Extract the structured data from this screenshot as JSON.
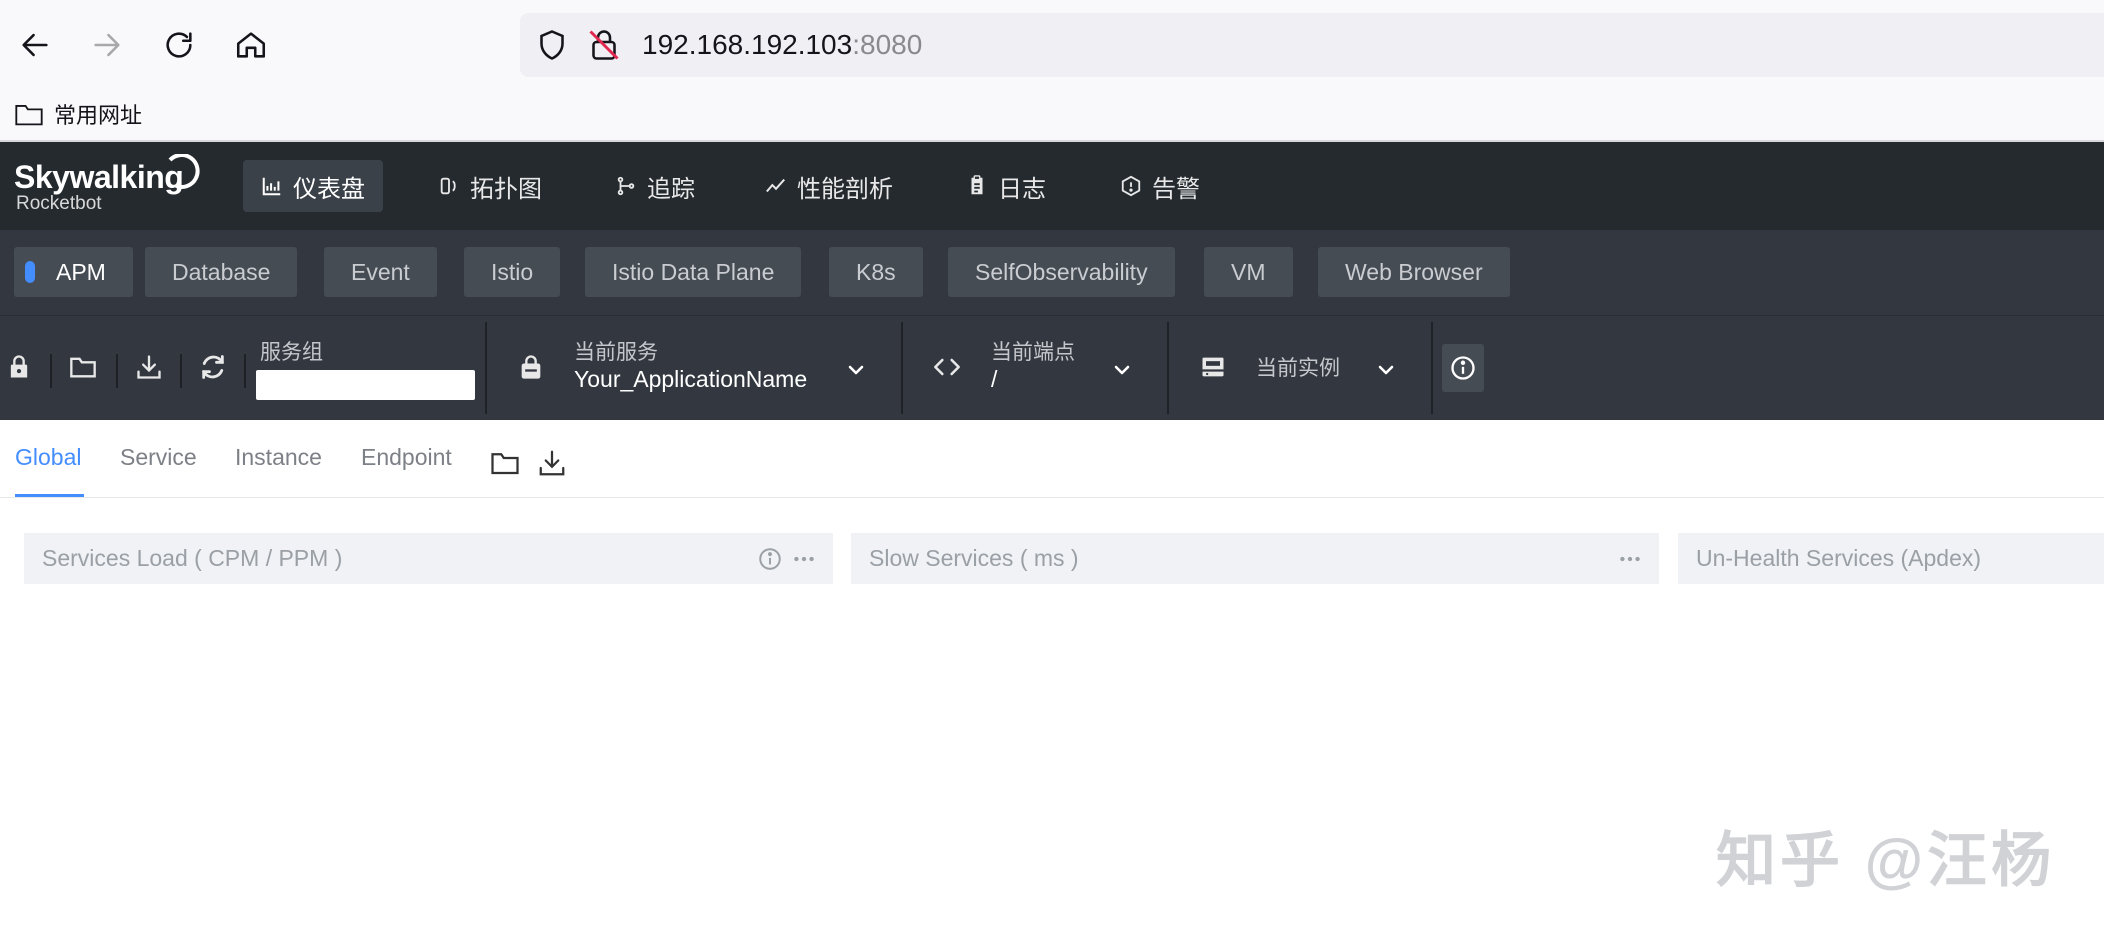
{
  "browser": {
    "url_host": "192.168.192.103",
    "url_port": ":8080",
    "bookmark_label": "常用网址"
  },
  "app": {
    "logo_main": "Skywalking",
    "logo_sub": "Rocketbot"
  },
  "nav_menu": [
    {
      "label": "仪表盘",
      "icon": "dashboard-chart-icon",
      "active": true
    },
    {
      "label": "拓扑图",
      "icon": "topology-icon",
      "active": false
    },
    {
      "label": "追踪",
      "icon": "trace-icon",
      "active": false
    },
    {
      "label": "性能剖析",
      "icon": "profile-line-icon",
      "active": false
    },
    {
      "label": "日志",
      "icon": "log-clipboard-icon",
      "active": false
    },
    {
      "label": "告警",
      "icon": "alarm-icon",
      "active": false
    }
  ],
  "templates": [
    {
      "label": "APM",
      "active": true
    },
    {
      "label": "Database"
    },
    {
      "label": "Event"
    },
    {
      "label": "Istio"
    },
    {
      "label": "Istio Data Plane"
    },
    {
      "label": "K8s"
    },
    {
      "label": "SelfObservability"
    },
    {
      "label": "VM"
    },
    {
      "label": "Web Browser"
    }
  ],
  "selectors": {
    "service_group_label": "服务组",
    "service_group_value": "",
    "current_service_label": "当前服务",
    "current_service_value": "Your_ApplicationName",
    "current_endpoint_label": "当前端点",
    "current_endpoint_value": "/",
    "current_instance_label": "当前实例",
    "current_instance_value": ""
  },
  "dashboard_tabs": [
    {
      "label": "Global",
      "active": true
    },
    {
      "label": "Service"
    },
    {
      "label": "Instance"
    },
    {
      "label": "Endpoint"
    }
  ],
  "widgets": [
    {
      "title": "Services Load ( CPM / PPM )"
    },
    {
      "title": "Slow Services ( ms )"
    },
    {
      "title": "Un-Health Services (Apdex)"
    }
  ],
  "watermark": "知乎 @汪杨",
  "colors": {
    "header_bg": "#252a2f",
    "toolbar_bg": "#333840",
    "accent": "#448dfe"
  }
}
